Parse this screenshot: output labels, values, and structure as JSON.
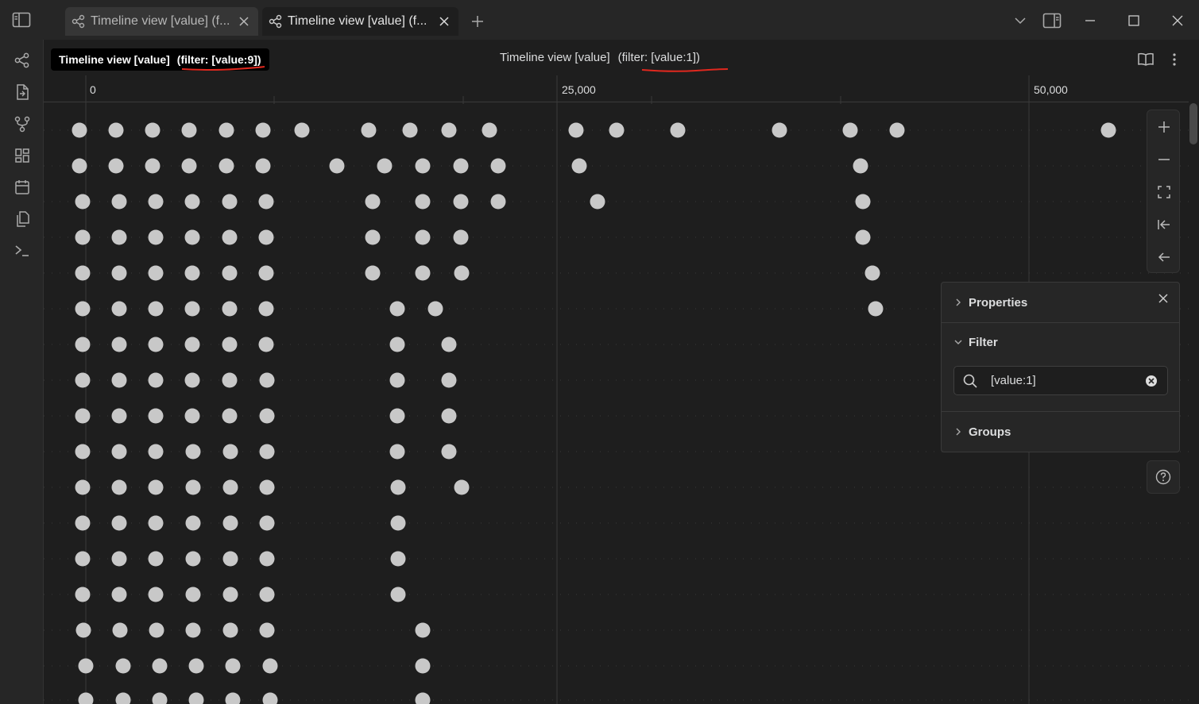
{
  "tabs": [
    {
      "label": "Timeline view [value] (f...",
      "active": false
    },
    {
      "label": "Timeline view [value] (f...",
      "active": true
    }
  ],
  "header": {
    "title": "Timeline view [value]",
    "filter": "(filter: [value:1])"
  },
  "tooltip": {
    "title": "Timeline view [value]",
    "filter": "(filter: [value:9])"
  },
  "axis": {
    "tick_labels": [
      "0",
      "25,000",
      "50,000"
    ]
  },
  "panel": {
    "properties_label": "Properties",
    "filter_label": "Filter",
    "filter_value": "[value:1]",
    "groups_label": "Groups"
  },
  "colors": {
    "background": "#1e1e1e",
    "node": "#c8c8c8",
    "annotation_underline": "#e0281e"
  },
  "icons": {
    "ribbon": [
      "graph-icon",
      "open-file-icon",
      "git-branch-icon",
      "dashboard-icon",
      "calendar-icon",
      "copy-icon",
      "terminal-icon"
    ],
    "controls": [
      "zoom-in-icon",
      "zoom-out-icon",
      "fit-to-screen-icon",
      "jump-to-start-icon",
      "back-arrow-icon"
    ]
  }
}
